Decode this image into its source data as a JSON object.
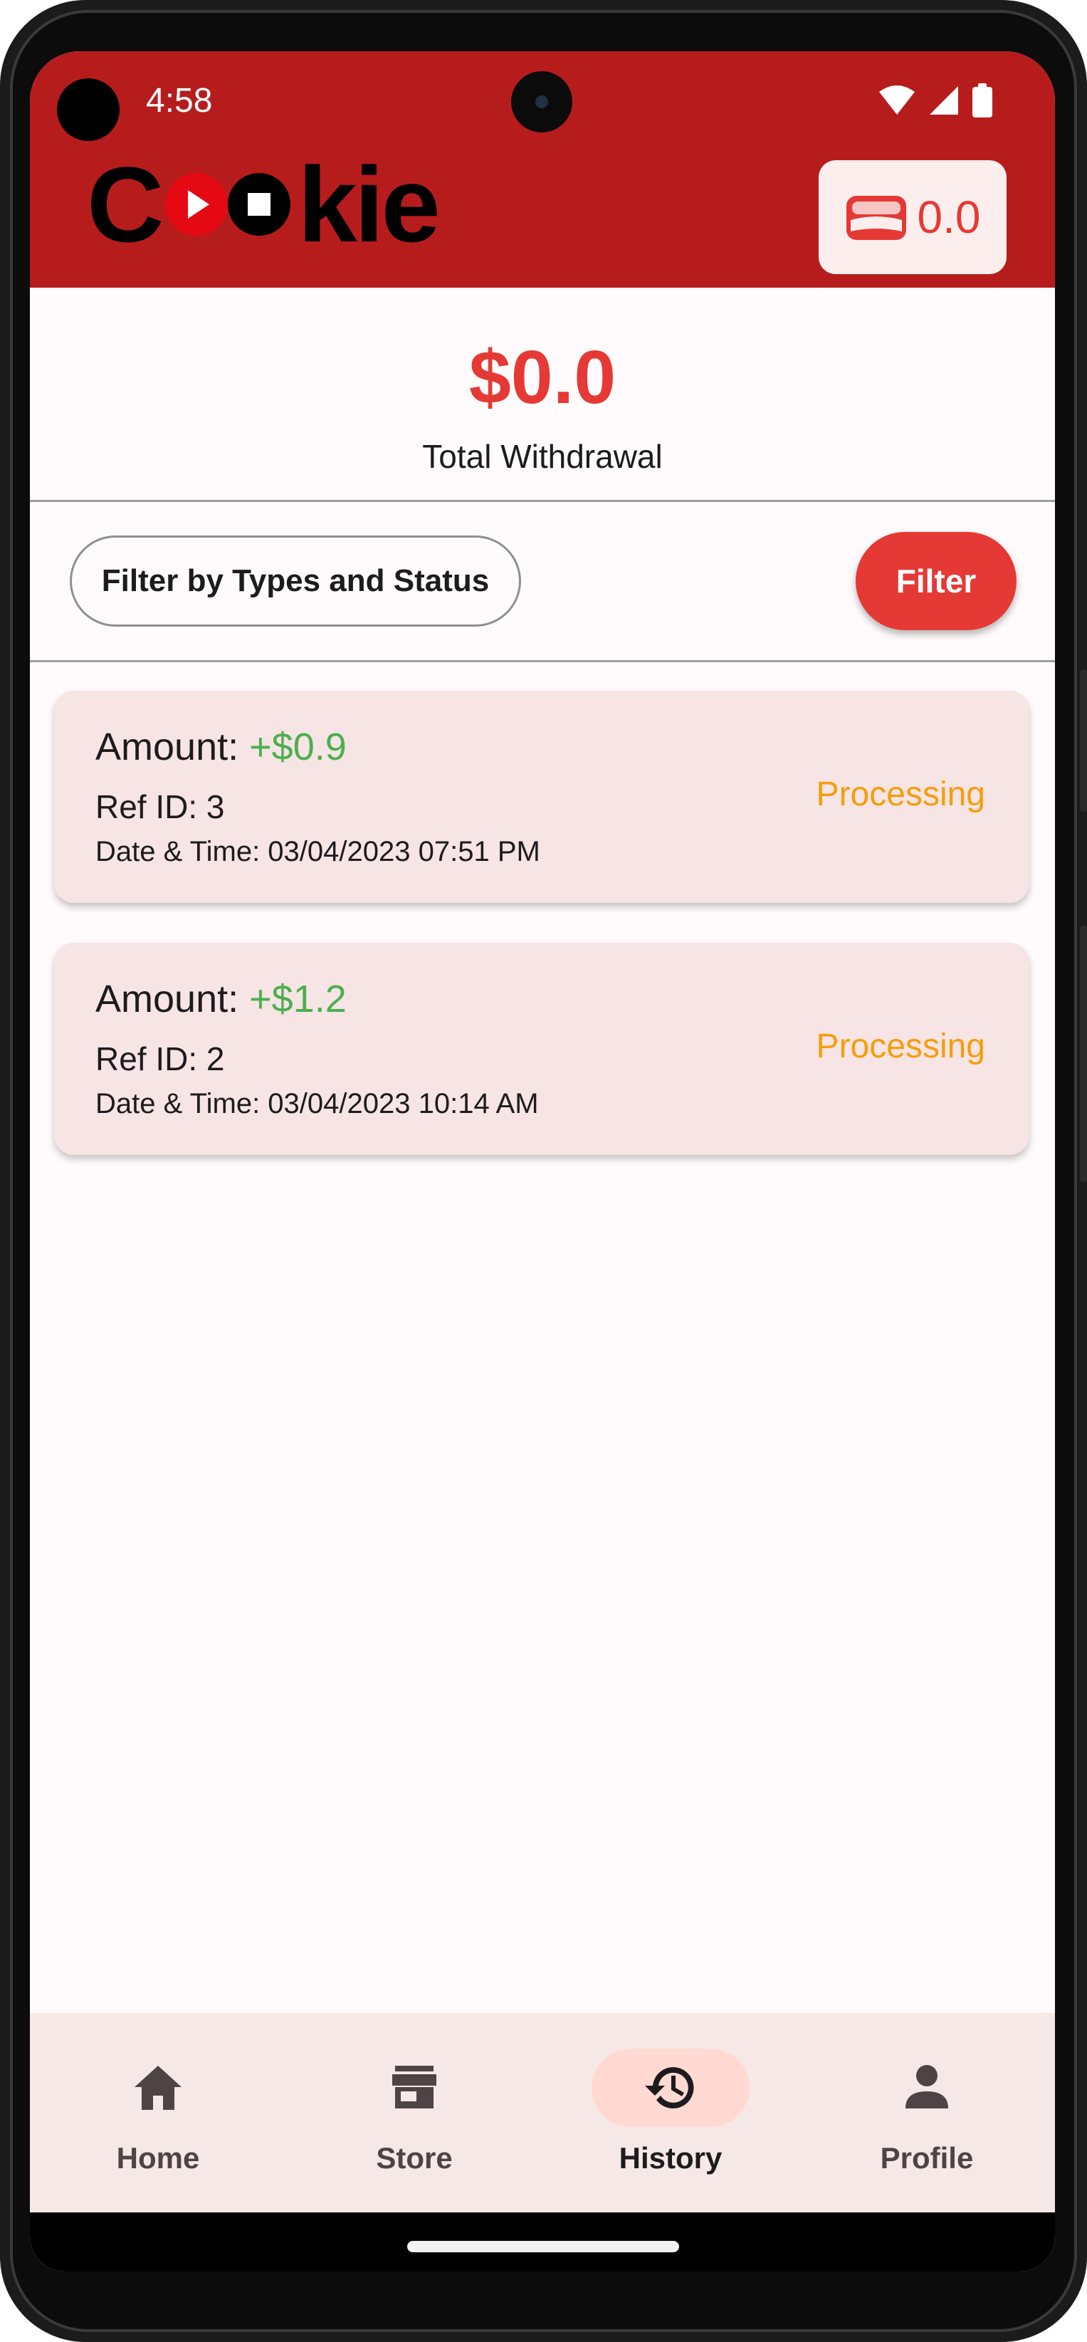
{
  "status_bar": {
    "time": "4:58"
  },
  "header": {
    "logo_text_left": "C",
    "logo_text_right": "kie",
    "wallet_balance": "0.0"
  },
  "summary": {
    "total_amount": "$0.0",
    "total_label": "Total Withdrawal"
  },
  "filters": {
    "select_label": "Filter by Types and Status",
    "button_label": "Filter"
  },
  "transactions": [
    {
      "amount_label": "Amount:",
      "amount_value": "+$0.9",
      "ref": "Ref ID: 3",
      "datetime": "Date & Time: 03/04/2023 07:51 PM",
      "status": "Processing"
    },
    {
      "amount_label": "Amount:",
      "amount_value": "+$1.2",
      "ref": "Ref ID: 2",
      "datetime": "Date & Time: 03/04/2023 10:14 AM",
      "status": "Processing"
    }
  ],
  "bottom_nav": {
    "items": [
      {
        "label": "Home",
        "icon": "home-icon"
      },
      {
        "label": "Store",
        "icon": "store-icon"
      },
      {
        "label": "History",
        "icon": "history-icon",
        "active": true
      },
      {
        "label": "Profile",
        "icon": "person-icon"
      }
    ]
  },
  "colors": {
    "header": "#b71c1c",
    "accent": "#e53935",
    "positive": "#4caf50",
    "status_processing": "#f59e0b"
  }
}
